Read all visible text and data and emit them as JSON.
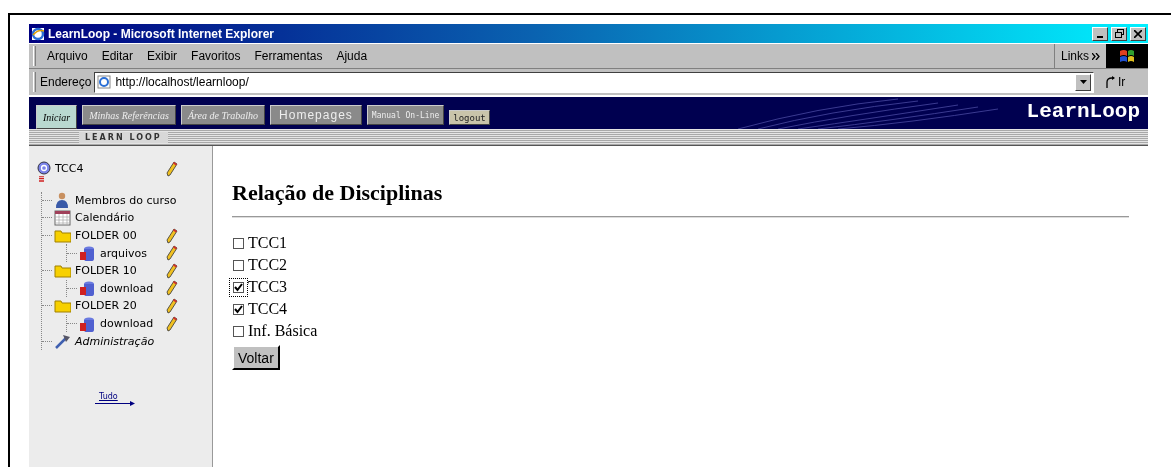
{
  "window": {
    "title": "LearnLoop - Microsoft Internet Explorer"
  },
  "menu": [
    "Arquivo",
    "Editar",
    "Exibir",
    "Favoritos",
    "Ferramentas",
    "Ajuda"
  ],
  "links_label": "Links",
  "address": {
    "label": "Endereço",
    "value": "http://localhost/learnloop/",
    "go": "Ir"
  },
  "nav_tabs": [
    {
      "label": "Iniciar",
      "kind": "script",
      "selected": true
    },
    {
      "label": "Minhas Referências",
      "kind": "script",
      "selected": false
    },
    {
      "label": "Área de Trabalho",
      "kind": "script",
      "selected": false
    },
    {
      "label": "Homepages",
      "kind": "plain",
      "selected": false
    },
    {
      "label": "Manual On-Line",
      "kind": "mono",
      "selected": false
    },
    {
      "label": "logout",
      "kind": "small",
      "selected": false
    }
  ],
  "brand": "LearnLoop",
  "sidebar": {
    "header": "LEARN LOOP",
    "tree": {
      "label": "TCC4",
      "kind": "course",
      "editable": true,
      "children": [
        {
          "label": "Membros do curso",
          "kind": "person",
          "editable": false
        },
        {
          "label": "Calendário",
          "kind": "calendar",
          "editable": false
        },
        {
          "label": "FOLDER 00",
          "kind": "folder",
          "editable": true,
          "children": [
            {
              "label": "arquivos",
              "kind": "storage",
              "editable": true
            }
          ]
        },
        {
          "label": "FOLDER 10",
          "kind": "folder",
          "editable": true,
          "children": [
            {
              "label": "download",
              "kind": "storage",
              "editable": true
            }
          ]
        },
        {
          "label": "FOLDER 20",
          "kind": "folder",
          "editable": true,
          "children": [
            {
              "label": "download",
              "kind": "storage",
              "editable": true
            }
          ]
        },
        {
          "label": "Administração",
          "kind": "tools",
          "editable": false
        }
      ]
    },
    "footer_link": "Tudo"
  },
  "content": {
    "heading": "Relação de Disciplinas",
    "options": [
      {
        "label": "TCC1",
        "checked": false,
        "focused": false
      },
      {
        "label": "TCC2",
        "checked": false,
        "focused": false
      },
      {
        "label": "TCC3",
        "checked": true,
        "focused": true
      },
      {
        "label": "TCC4",
        "checked": true,
        "focused": false
      },
      {
        "label": "Inf. Básica",
        "checked": false,
        "focused": false
      }
    ],
    "button": "Voltar"
  }
}
